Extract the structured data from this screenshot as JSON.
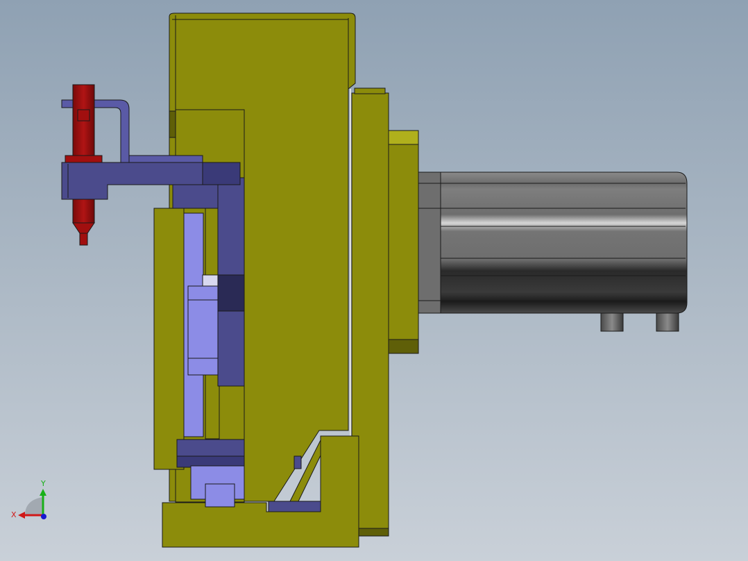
{
  "viewport": {
    "background_top": "#8fa1b3",
    "background_bottom": "#c9d0d8"
  },
  "colors": {
    "olive": "#8c8c0b",
    "olive_dark": "#5f5f08",
    "olive_light": "#b0b01c",
    "blue_dark": "#4b4b8c",
    "blue_mid": "#5a5aa6",
    "blue_light": "#8c8ce6",
    "blue_deep": "#2a2a55",
    "red": "#a10f0f",
    "red_dark": "#6e0808",
    "gray_dark": "#3c3c3c",
    "gray_mid": "#6e6e6e",
    "gray_light": "#9a9a9a",
    "outline": "#1a1a1a"
  },
  "triad": {
    "x_label": "X",
    "y_label": "Y",
    "x_color": "#d01818",
    "y_color": "#18b018",
    "z_color": "#1818d0"
  }
}
